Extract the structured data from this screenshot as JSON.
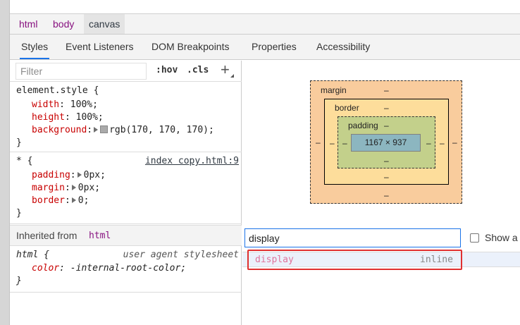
{
  "breadcrumbs": [
    "html",
    "body",
    "canvas"
  ],
  "tabs": [
    "Styles",
    "Event Listeners",
    "DOM Breakpoints",
    "Properties",
    "Accessibility"
  ],
  "styles_toolbar": {
    "filter_placeholder": "Filter",
    "hov_label": ":hov",
    "cls_label": ".cls",
    "add_rule_label": "+"
  },
  "element_style": {
    "selector": "element.style {",
    "close": "}",
    "width_prop": "width",
    "width_val": "100%;",
    "height_prop": "height",
    "height_val": "100%;",
    "background_prop": "background",
    "background_val": "rgb(170, 170, 170);",
    "swatch_color": "#aaaaaa"
  },
  "universal_rule": {
    "selector": "* {",
    "source": "index copy.html:9",
    "close": "}",
    "padding_prop": "padding",
    "padding_val": "0px;",
    "margin_prop": "margin",
    "margin_val": "0px;",
    "border_prop": "border",
    "border_val": "0;"
  },
  "inherited": {
    "label": "Inherited from",
    "tag": "html"
  },
  "html_rule": {
    "selector": "html {",
    "source": "user agent stylesheet",
    "close": "}",
    "color_prop": "color",
    "color_val": "-internal-root-color;"
  },
  "box_model": {
    "margin_label": "margin",
    "border_label": "border",
    "padding_label": "padding",
    "dash": "–",
    "content_size": "1167 × 937"
  },
  "computed": {
    "search_value": "display",
    "show_all_label": "Show a",
    "property": "display",
    "value": "inline"
  },
  "colors": {
    "accent": "#1a73e8",
    "highlight": "#e03030",
    "margin": "#f9cc9d",
    "border": "#fddd9b",
    "padding": "#c3d08b",
    "content": "#8cb6c0"
  }
}
